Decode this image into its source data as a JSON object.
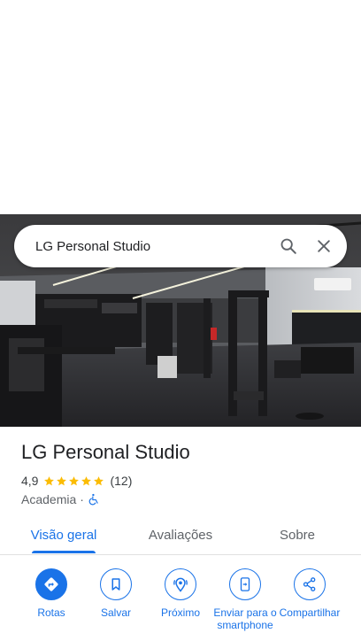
{
  "search": {
    "query": "LG Personal Studio"
  },
  "place": {
    "title": "LG Personal Studio",
    "rating": "4,9",
    "stars": 5,
    "review_count": "(12)",
    "category": "Academia",
    "separator": "·"
  },
  "tabs": [
    {
      "label": "Visão geral",
      "active": true
    },
    {
      "label": "Avaliações",
      "active": false
    },
    {
      "label": "Sobre",
      "active": false
    }
  ],
  "actions": [
    {
      "label": "Rotas",
      "icon": "directions-icon"
    },
    {
      "label": "Salvar",
      "icon": "bookmark-icon"
    },
    {
      "label": "Próximo",
      "icon": "nearby-icon"
    },
    {
      "label": "Enviar para o smartphone",
      "icon": "send-to-phone-icon"
    },
    {
      "label": "Compartilhar",
      "icon": "share-icon"
    }
  ],
  "colors": {
    "accent": "#1a73e8",
    "star": "#fbbc04"
  }
}
